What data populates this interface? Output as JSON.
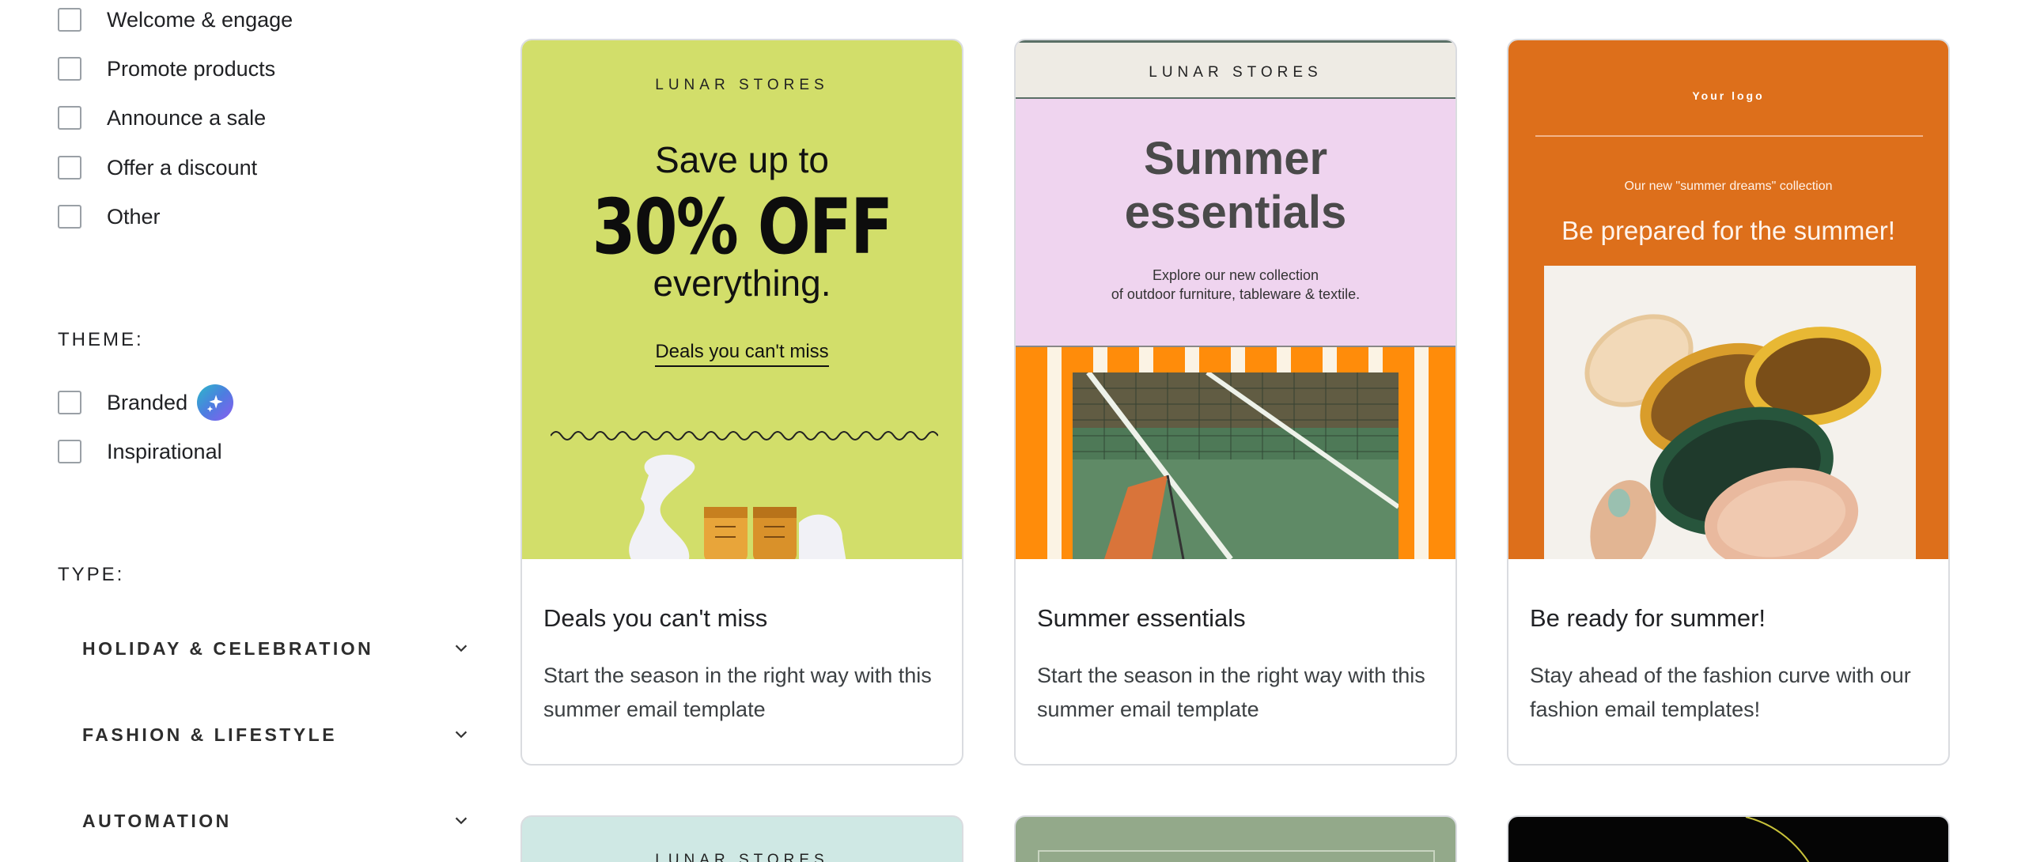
{
  "sidebar": {
    "goals": [
      {
        "label": "Welcome & engage",
        "checked": false
      },
      {
        "label": "Promote products",
        "checked": false
      },
      {
        "label": "Announce a sale",
        "checked": false
      },
      {
        "label": "Offer a discount",
        "checked": false
      },
      {
        "label": "Other",
        "checked": false
      }
    ],
    "theme_heading": "THEME:",
    "themes": [
      {
        "label": "Branded",
        "checked": false,
        "badge_icon": "ai-sparkle-icon"
      },
      {
        "label": "Inspirational",
        "checked": false
      }
    ],
    "type_heading": "TYPE:",
    "types": [
      {
        "label": "HOLIDAY & CELEBRATION",
        "icon": "chevron-down-icon"
      },
      {
        "label": "FASHION & LIFESTYLE",
        "icon": "chevron-down-icon"
      },
      {
        "label": "AUTOMATION",
        "icon": "chevron-down-icon"
      }
    ]
  },
  "templates": [
    {
      "title": "Deals you can't miss",
      "description": "Start the season in the right way with this summer email template",
      "preview": {
        "brand": "LUNAR STORES",
        "line1": "Save up to",
        "line2": "30% OFF",
        "line3": "everything.",
        "cta": "Deals you can't miss",
        "background": "#d2de6a"
      }
    },
    {
      "title": "Summer essentials",
      "description": "Start the season in the right way with this summer email template",
      "preview": {
        "brand": "LUNAR STORES",
        "heading_line1": "Summer",
        "heading_line2": "essentials",
        "sub_line1": "Explore our new collection",
        "sub_line2": "of outdoor furniture, tableware & textile.",
        "background": "#efd4ef"
      }
    },
    {
      "title": "Be ready for summer!",
      "description": "Stay ahead of the fashion curve with our fashion email templates!",
      "preview": {
        "logo": "Your logo",
        "small": "Our new \"summer dreams\" collection",
        "big": "Be prepared for the summer!",
        "background": "#dd6f1b"
      }
    }
  ],
  "next_row": [
    {
      "brand": "LUNAR STORES",
      "background": "#cfe8e4"
    },
    {
      "background": "#93a98a"
    },
    {
      "background": "#050505"
    }
  ]
}
